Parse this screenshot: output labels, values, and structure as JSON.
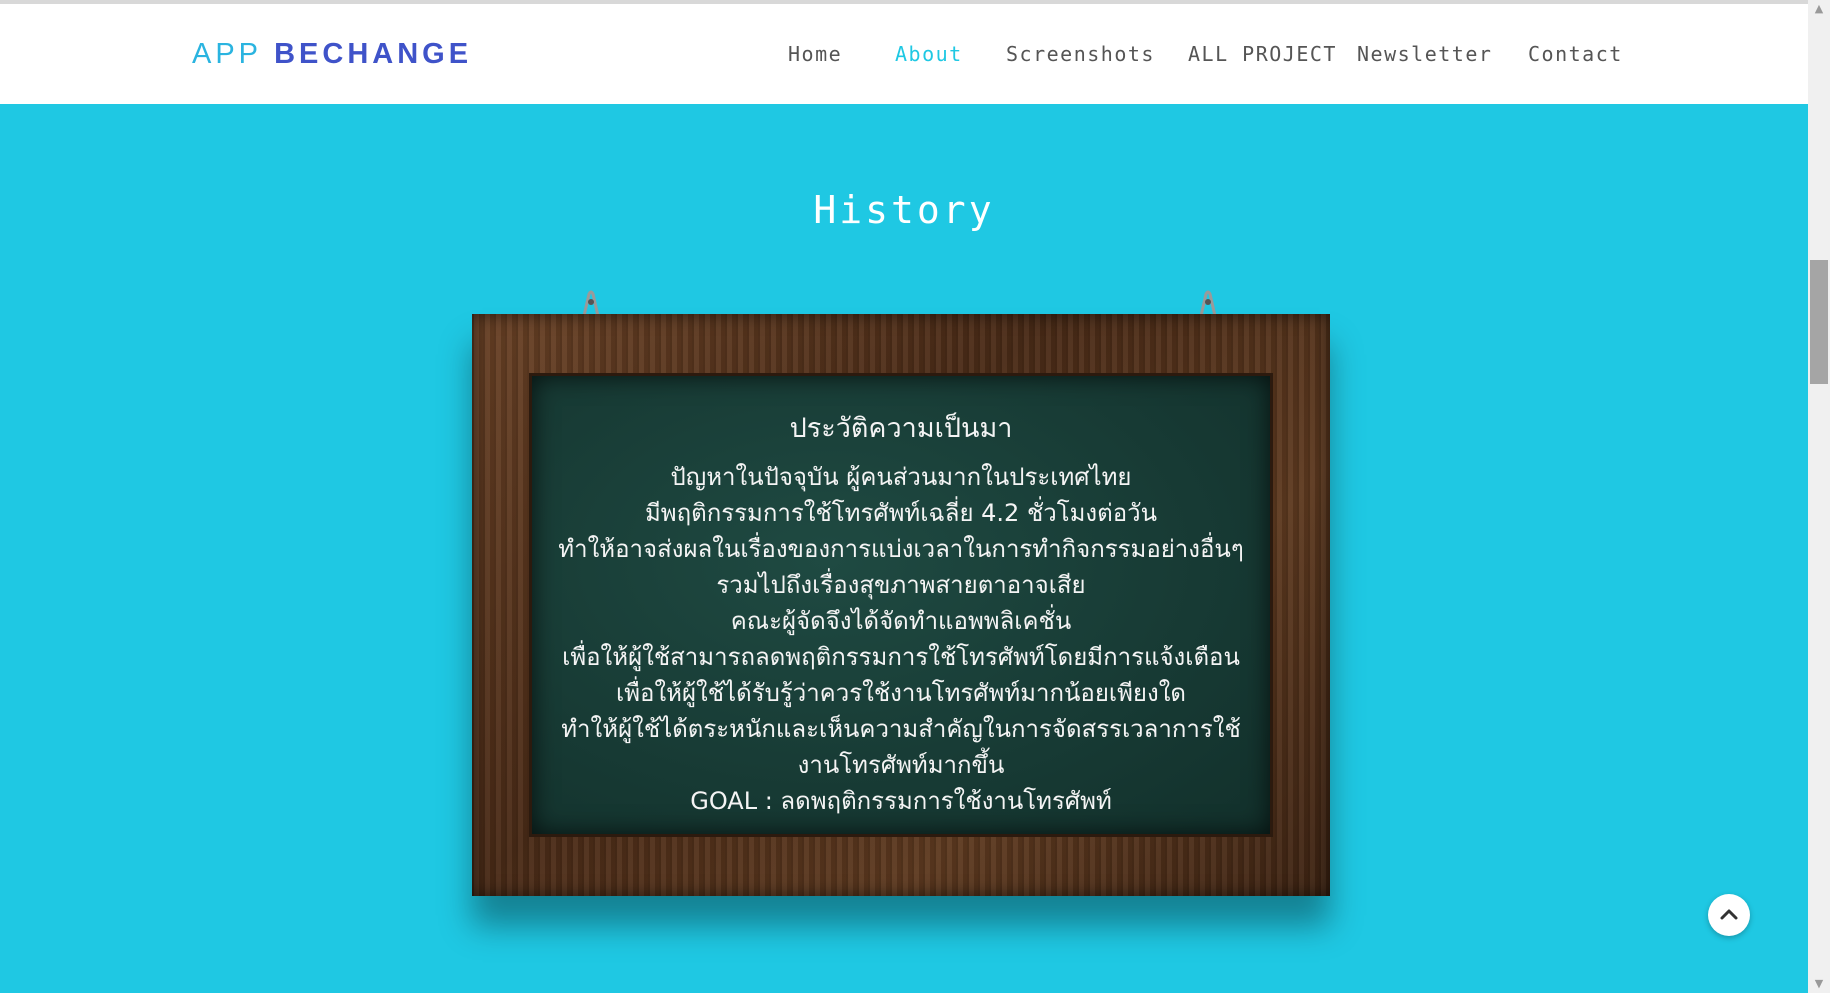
{
  "brand": {
    "part1": "APP",
    "part2": "BECHANGE"
  },
  "nav": {
    "items": [
      {
        "label": "Home",
        "active": false
      },
      {
        "label": "About",
        "active": true
      },
      {
        "label": "Screenshots",
        "active": false
      },
      {
        "label": "ALL PROJECT",
        "active": false
      },
      {
        "label": "Newsletter",
        "active": false
      },
      {
        "label": "Contact",
        "active": false
      }
    ]
  },
  "section": {
    "title": "History"
  },
  "board": {
    "title": "ประวัติความเป็นมา",
    "lines": [
      "ปัญหาในปัจจุบัน ผู้คนส่วนมากในประเทศไทย",
      "มีพฤติกรรมการใช้โทรศัพท์เฉลี่ย 4.2 ชั่วโมงต่อวัน",
      "ทำให้อาจส่งผลในเรื่องของการแบ่งเวลาในการทำกิจกรรมอย่างอื่นๆ",
      "รวมไปถึงเรื่องสุขภาพสายตาอาจเสีย",
      "คณะผู้จัดจึงได้จัดทำแอพพลิเคชั่น",
      "เพื่อให้ผู้ใช้สามารถลดพฤติกรรมการใช้โทรศัพท์โดยมีการแจ้งเตือน",
      "เพื่อให้ผู้ใช้ได้รับรู้ว่าควรใช้งานโทรศัพท์มากน้อยเพียงใด",
      "ทำให้ผู้ใช้ได้ตระหนักและเห็นความสำคัญในการจัดสรรเวลาการใช้",
      "งานโทรศัพท์มากขึ้น"
    ],
    "goal": "GOAL : ลดพฤติกรรมการใช้งานโทรศัพท์"
  },
  "colors": {
    "accent": "#1fc8e3",
    "brand_blue": "#3f53c9",
    "brand_light": "#2ab4e0"
  },
  "icons": {
    "back_to_top": "chevron-up-icon"
  }
}
